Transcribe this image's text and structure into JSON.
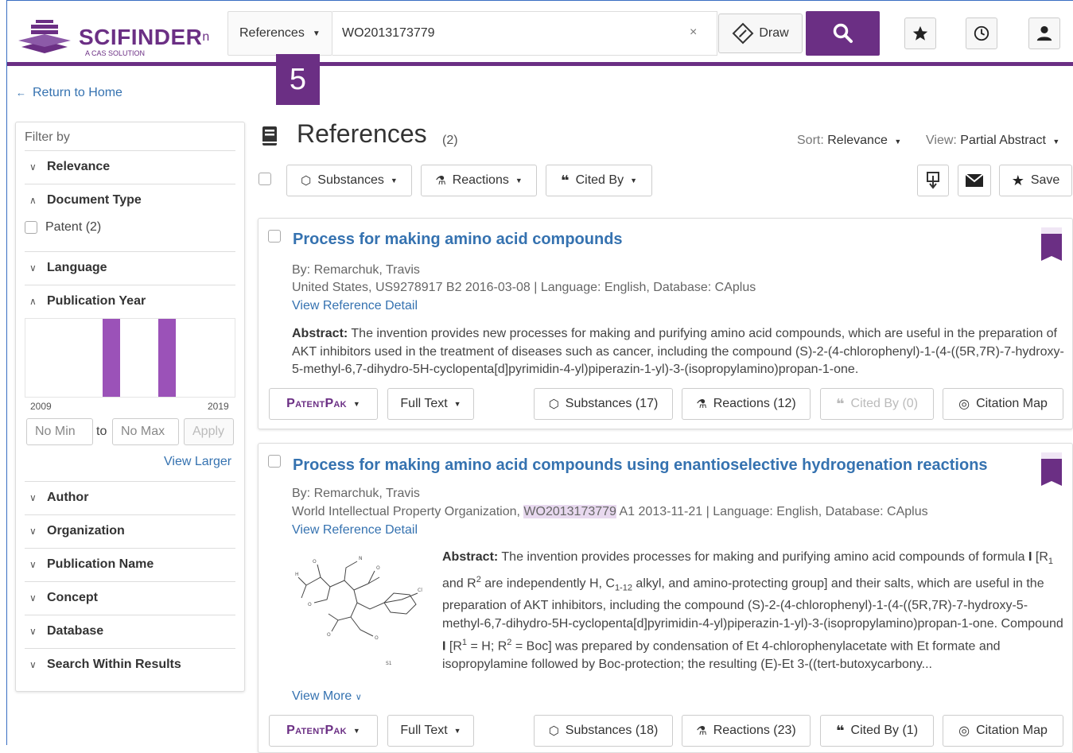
{
  "header": {
    "logo_name": "SCIFINDER",
    "logo_sup": "n",
    "logo_sub": "A CAS SOLUTION",
    "search_type": "References",
    "search_value": "WO2013173779",
    "clear": "×",
    "draw_label": "Draw"
  },
  "step_badge": "5",
  "nav": {
    "return_home": "Return to Home"
  },
  "sidebar": {
    "filter_by": "Filter by",
    "sections": {
      "relevance": "Relevance",
      "document_type": "Document Type",
      "language": "Language",
      "publication_year": "Publication Year",
      "author": "Author",
      "organization": "Organization",
      "publication_name": "Publication Name",
      "concept": "Concept",
      "database": "Database",
      "search_within": "Search Within Results"
    },
    "patent_option": "Patent (2)",
    "year_start": "2009",
    "year_end": "2019",
    "min_placeholder": "No Min",
    "to_label": "to",
    "max_placeholder": "No Max",
    "apply": "Apply",
    "view_larger": "View Larger"
  },
  "main": {
    "title": "References",
    "count": "(2)",
    "sort_label": "Sort:",
    "sort_value": "Relevance",
    "view_label": "View:",
    "view_value": "Partial Abstract",
    "toolbar": {
      "substances": "Substances",
      "reactions": "Reactions",
      "cited_by": "Cited By",
      "save": "Save"
    }
  },
  "results": [
    {
      "title": "Process for making amino acid compounds",
      "authors": "By: Remarchuk, Travis",
      "source": "United States, US9278917 B2 2016-03-08 | Language: English, Database: CAplus",
      "detail_link": "View Reference Detail",
      "abstract_label": "Abstract:",
      "abstract": "The invention provides new processes for making and purifying amino acid compounds, which are useful in the preparation of AKT inhibitors used in the treatment of diseases such as cancer, including the compound (S)-2-(4-chlorophenyl)-1-(4-((5R,7R)-7-hydroxy-5-methyl-6,7-dihydro-5H-cyclopenta[d]pyrimidin-4-yl)piperazin-1-yl)-3-(isopropylamino)propan-1-one.",
      "patentpak": "PatentPak",
      "full_text": "Full Text",
      "substances": "Substances (17)",
      "reactions": "Reactions (12)",
      "cited_by": "Cited By (0)",
      "citation_map": "Citation Map"
    },
    {
      "title": "Process for making amino acid compounds using enantioselective hydrogenation reactions",
      "authors": "By: Remarchuk, Travis",
      "source_pre": "World Intellectual Property Organization,",
      "source_hl": "WO2013173779",
      "source_post": "A1 2013-11-21 | Language: English, Database: CAplus",
      "detail_link": "View Reference Detail",
      "abstract_label": "Abstract:",
      "abstract_line1": "The invention provides processes for making and purifying amino acid compounds of",
      "abstract_line2_a": "formula",
      "abstract_line2_b": "I",
      "abstract_line2_c": "[R",
      "abstract_line2_d": "1",
      "abstract_line2_e": "and R",
      "abstract_line2_f": "2",
      "abstract_line2_g": "are independently H, C",
      "abstract_line2_h": "1-12",
      "abstract_line2_i": "alkyl, and amino-protecting group] and their salts, which",
      "abstract_rest": "are useful in the preparation of AKT inhibitors, including the compound (S)-2-(4-chlorophenyl)-1-(4-((5R,7R)-7-hydroxy-5-methyl-6,7-dihydro-5H-cyclopenta[d]pyrimidin-4-yl)piperazin-1-yl)-3-(isopropylamino)propan-1-one. Compound",
      "abstract_cmp": "I",
      "abstract_r1": "[R",
      "abstract_r1_sup": "1",
      "abstract_r1_val": "= H; R",
      "abstract_r2_sup": "2",
      "abstract_tail": "= Boc] was prepared by condensation of Et 4-chlorophenylacetate with Et formate and isopropylamine followed by Boc-protection; the resulting (E)-Et 3-((tert-butoxycarbony...",
      "view_more": "View More",
      "patentpak": "PatentPak",
      "full_text": "Full Text",
      "substances": "Substances (18)",
      "reactions": "Reactions (23)",
      "cited_by": "Cited By (1)",
      "citation_map": "Citation Map"
    }
  ],
  "colors": {
    "brand": "#6b2f84",
    "link": "#3572b0",
    "histogram_bar": "#9b52b8"
  }
}
